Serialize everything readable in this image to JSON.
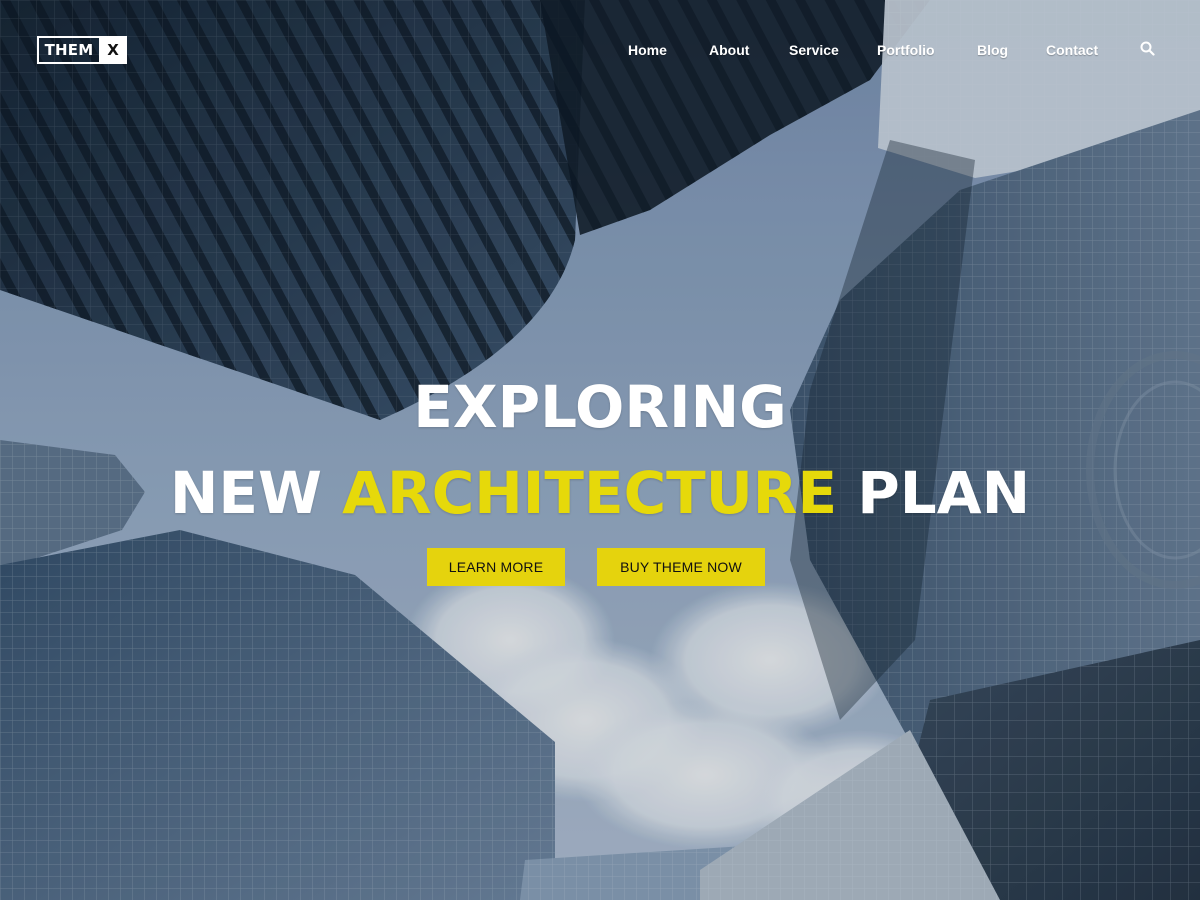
{
  "site": {
    "logo": {
      "main": "THEM",
      "accent": "X"
    },
    "nav": {
      "items": [
        {
          "label": "Home"
        },
        {
          "label": "About"
        },
        {
          "label": "Service"
        },
        {
          "label": "Portfolio"
        },
        {
          "label": "Blog"
        },
        {
          "label": "Contact"
        }
      ],
      "search_icon": "search-icon"
    }
  },
  "hero": {
    "line1": "EXPLORING",
    "line2": {
      "prefix": "NEW ",
      "highlight": "ARCHITECTURE",
      "suffix": " PLAN"
    },
    "buttons": {
      "learn_more": "LEARN MORE",
      "buy_theme": "BUY THEME NOW"
    }
  },
  "colors": {
    "accent": "#e6d90a",
    "text_primary": "#ffffff",
    "button_text": "#111111"
  }
}
